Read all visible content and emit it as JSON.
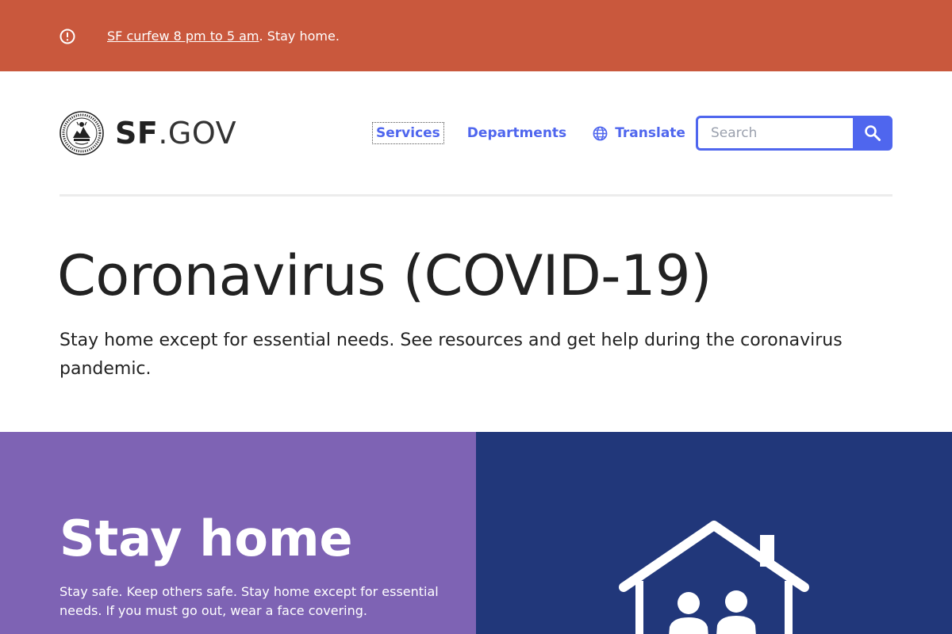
{
  "alert": {
    "link_text": "SF curfew 8 pm to  5 am",
    "suffix_text": ". Stay home.",
    "icon": "alert-circle-icon"
  },
  "header": {
    "logo_alt": "City and County of San Francisco seal",
    "wordmark_bold": "SF",
    "wordmark_light": ".GOV",
    "nav": {
      "services": "Services",
      "departments": "Departments",
      "translate": "Translate"
    },
    "search": {
      "placeholder": "Search",
      "icon": "search-icon"
    }
  },
  "hero": {
    "title": "Coronavirus (COVID-19)",
    "description": "Stay home except for essential needs. See resources and get help during the coronavirus pandemic."
  },
  "stay_home": {
    "heading": "Stay home",
    "body": "Stay safe. Keep others safe. Stay home except for essential needs. If you must go out, wear a face covering.",
    "illustration": "house-with-people-icon"
  },
  "colors": {
    "alert_bg": "#c9583d",
    "accent": "#4f66ee",
    "panel_purple": "#7e63b4",
    "panel_navy": "#21377a"
  }
}
